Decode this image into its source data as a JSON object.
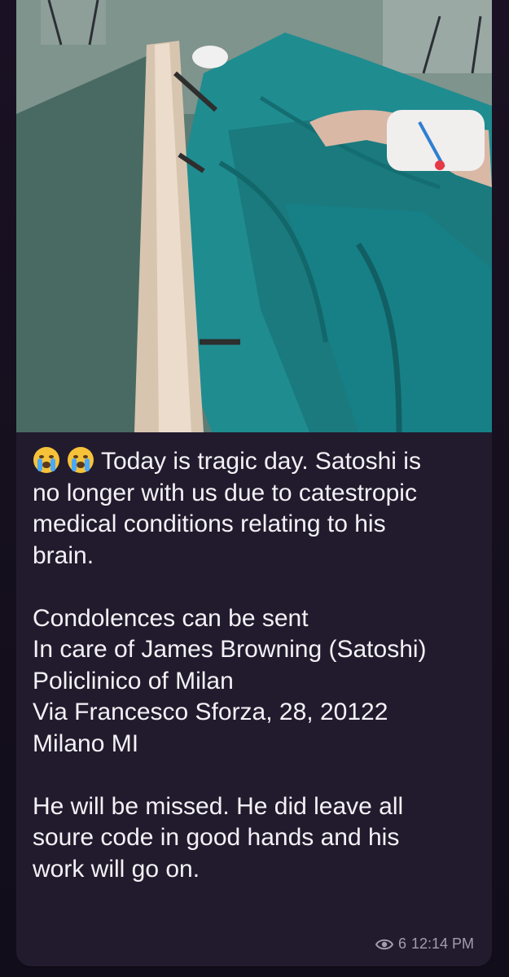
{
  "message": {
    "photo_description_icon": "hospital-bed-photo",
    "caption_lines": [
      "Today is tragic day. Satoshi is",
      "no longer with us due to catestropic",
      "medical conditions relating to his",
      "brain.",
      "",
      "Condolences can be sent",
      "In care of James Browning (Satoshi)",
      "Policlinico of Milan",
      "Via Francesco Sforza, 28, 20122",
      "Milano MI",
      "",
      "He will be missed. He did leave all",
      "soure code in good hands and his",
      "work will go on."
    ],
    "emoji": [
      "crying-face-emoji",
      "crying-face-emoji"
    ],
    "views": "6",
    "time": "12:14 PM"
  },
  "colors": {
    "bubble": "#221b2d",
    "text": "#f3f1f6",
    "meta": "#a39cb0",
    "sheet": "#1f8c90"
  }
}
